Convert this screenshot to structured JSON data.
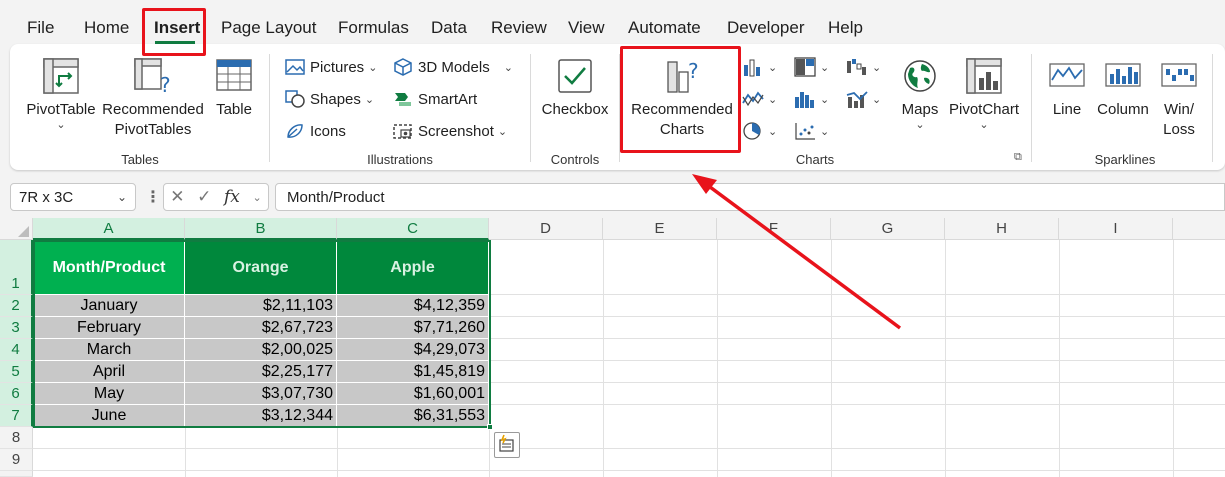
{
  "menu": {
    "tabs": [
      {
        "label": "File"
      },
      {
        "label": "Home"
      },
      {
        "label": "Insert",
        "active": true
      },
      {
        "label": "Page Layout"
      },
      {
        "label": "Formulas"
      },
      {
        "label": "Data"
      },
      {
        "label": "Review"
      },
      {
        "label": "View"
      },
      {
        "label": "Automate"
      },
      {
        "label": "Developer"
      },
      {
        "label": "Help"
      }
    ]
  },
  "ribbon": {
    "tables": {
      "group_label": "Tables",
      "pivottable": {
        "label": "PivotTable"
      },
      "recommended_pivottables": {
        "line1": "Recommended",
        "line2": "PivotTables"
      },
      "table": {
        "label": "Table"
      }
    },
    "illustrations": {
      "group_label": "Illustrations",
      "pictures": "Pictures",
      "shapes": "Shapes",
      "icons": "Icons",
      "models_3d": "3D Models",
      "smartart": "SmartArt",
      "screenshot": "Screenshot"
    },
    "controls": {
      "group_label": "Controls",
      "checkbox": "Checkbox"
    },
    "charts": {
      "group_label": "Charts",
      "recommended_charts": {
        "line1": "Recommended",
        "line2": "Charts"
      },
      "maps": "Maps",
      "pivotchart": "PivotChart"
    },
    "sparklines": {
      "group_label": "Sparklines",
      "line": "Line",
      "column": "Column",
      "winloss": {
        "line1": "Win/",
        "line2": "Loss"
      }
    }
  },
  "formula_bar": {
    "name_box": "7R x 3C",
    "fx": "fx",
    "formula": "Month/Product"
  },
  "sheet": {
    "columns": [
      "A",
      "B",
      "C",
      "D",
      "E",
      "F",
      "G",
      "H",
      "I"
    ],
    "rows": [
      "1",
      "2",
      "3",
      "4",
      "5",
      "6",
      "7",
      "8",
      "9"
    ],
    "headers": [
      "Month/Product",
      "Orange",
      "Apple"
    ],
    "data": [
      [
        "January",
        "$2,11,103",
        "$4,12,359"
      ],
      [
        "February",
        "$2,67,723",
        "$7,71,260"
      ],
      [
        "March",
        "$2,00,025",
        "$4,29,073"
      ],
      [
        "April",
        "$2,25,177",
        "$1,45,819"
      ],
      [
        "May",
        "$3,07,730",
        "$1,60,001"
      ],
      [
        "June",
        "$3,12,344",
        "$6,31,553"
      ]
    ]
  },
  "colors": {
    "header_a": "#00b050",
    "header_bc": "#00883c",
    "body": "#c8c8c8",
    "accent": "#107c41",
    "highlight": "#e8131b"
  }
}
